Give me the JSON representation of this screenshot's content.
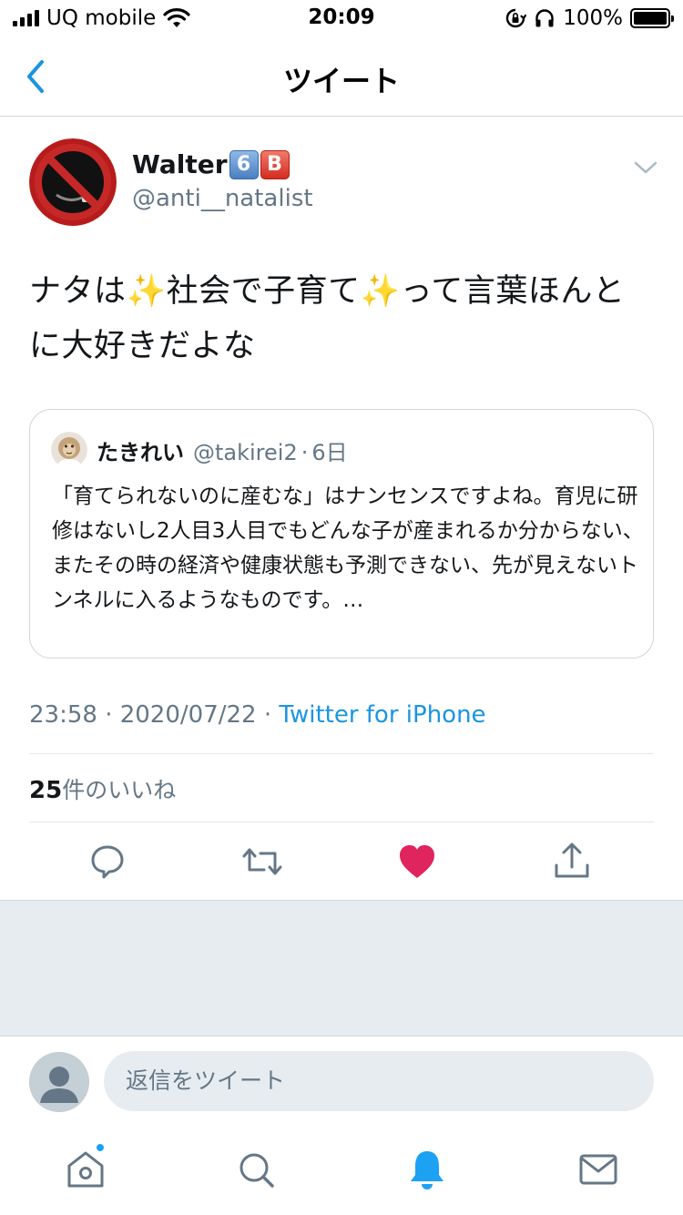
{
  "status_bar": {
    "carrier": "UQ mobile",
    "time": "20:09",
    "battery_percent": "100%",
    "battery_level": 1.0
  },
  "nav": {
    "title": "ツイート"
  },
  "tweet": {
    "author_name": "Walter",
    "badges": [
      "6",
      "B"
    ],
    "author_handle": "@anti__natalist",
    "text": "ナタは✨社会で子育て✨って言葉ほんとに大好きだよな",
    "quoted": {
      "name": "たきれい",
      "handle": "@takirei2",
      "separator": "·",
      "time": "6日",
      "text": "「育てられないのに産むな」はナンセンスですよね。育児に研修はないし2人目3人目でもどんな子が産まれるか分からない、またその時の経済や健康状態も予測できない、先が見えないトンネルに入るようなものです。…"
    },
    "timestamp": "23:58 · 2020/07/22 · ",
    "source": "Twitter for iPhone",
    "like_count": "25",
    "like_label": "件のいいね"
  },
  "reply": {
    "placeholder": "返信をツイート"
  },
  "colors": {
    "accent": "#1da1f2",
    "back_arrow": "#1b95e0",
    "like_active": "#e0245e",
    "secondary_text": "#657786",
    "icon_gray": "#657786"
  },
  "icons": {
    "back": "chevron-left-icon",
    "more": "chevron-down-icon",
    "reply": "comment-icon",
    "retweet": "retweet-icon",
    "like": "heart-icon",
    "share": "share-icon",
    "home": "home-icon",
    "search": "search-icon",
    "notifications": "bell-icon",
    "messages": "mail-icon"
  }
}
